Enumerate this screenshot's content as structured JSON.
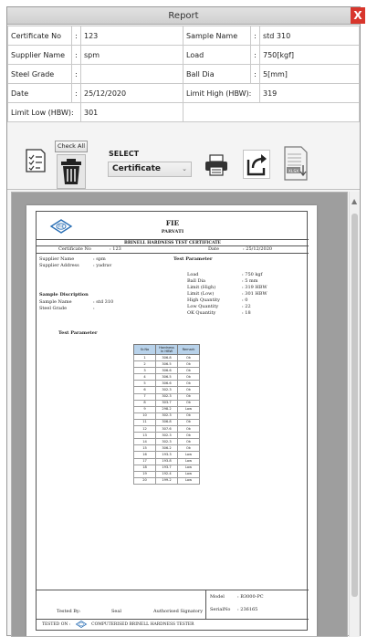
{
  "window": {
    "title": "Report",
    "close_label": "X"
  },
  "info": {
    "certificate_no": {
      "label": "Certificate No",
      "sep": ":",
      "value": "123"
    },
    "sample_name": {
      "label": "Sample Name",
      "sep": ":",
      "value": "std 310"
    },
    "supplier_name": {
      "label": "Supplier Name",
      "sep": ":",
      "value": "spm"
    },
    "load": {
      "label": "Load",
      "sep": ":",
      "value": "750[kgf]"
    },
    "steel_grade": {
      "label": "Steel Grade",
      "sep": ":",
      "value": ""
    },
    "ball_dia": {
      "label": "Ball Dia",
      "sep": ":",
      "value": "5[mm]"
    },
    "date": {
      "label": "Date",
      "sep": ":",
      "value": "25/12/2020"
    },
    "limit_high": {
      "label": "Limit High (HBW):",
      "value": "319"
    },
    "limit_low": {
      "label": "Limit Low (HBW):",
      "value": "301"
    }
  },
  "toolbar": {
    "check_all_label": "Check All",
    "select_label": "SELECT",
    "select_value": "Certificate",
    "icons": [
      "list-check-icon",
      "trash-icon",
      "printer-icon",
      "export-icon",
      "xlsx-download-icon"
    ]
  },
  "preview": {
    "company": "FIE",
    "company_sub": "PARVATI",
    "cert_title": "BRINELL HARDNESS TEST CERTIFICATE",
    "cert_no_label": "Certificate No",
    "cert_no": ": 123",
    "date_label": "Date",
    "date": ": 25/12/2020",
    "supplier_name_label": "Supplier Name",
    "supplier_name": ": spm",
    "supplier_address_label": "Supplier Address",
    "supplier_address": ": yadrav",
    "test_parameter_heading": "Test Parameter",
    "params": [
      {
        "label": "Load",
        "value": ": 750 kgf"
      },
      {
        "label": "Ball Dia",
        "value": ": 5 mm"
      },
      {
        "label": "Limit (High)",
        "value": ": 319 HBW"
      },
      {
        "label": "Limit (Low)",
        "value": ": 301 HBW"
      },
      {
        "label": "High Quantity",
        "value": ": 0"
      },
      {
        "label": "Low Quantity",
        "value": ": 22"
      },
      {
        "label": "OK Quantity",
        "value": ": 18"
      }
    ],
    "sample_description_heading": "Sample Discription",
    "sample_name_label": "Sample Name",
    "sample_name": ": std 310",
    "steel_grade_label": "Steel Grade",
    "steel_grade": ":",
    "test_parameter_label": "Test Parameter",
    "table_headers": [
      "Sr.No",
      "Hardness In HBW",
      "Remark"
    ],
    "table_rows": [
      [
        "1",
        "306.8",
        "Ok"
      ],
      [
        "2",
        "306.5",
        "Ok"
      ],
      [
        "3",
        "306.6",
        "Ok"
      ],
      [
        "4",
        "306.5",
        "Ok"
      ],
      [
        "5",
        "306.6",
        "Ok"
      ],
      [
        "6",
        "302.3",
        "Ok"
      ],
      [
        "7",
        "302.3",
        "Ok"
      ],
      [
        "8",
        "303.7",
        "Ok"
      ],
      [
        "9",
        "298.2",
        "Low"
      ],
      [
        "10",
        "302.3",
        "Ok"
      ],
      [
        "11",
        "306.8",
        "Ok"
      ],
      [
        "12",
        "307.6",
        "Ok"
      ],
      [
        "13",
        "302.3",
        "Ok"
      ],
      [
        "14",
        "302.3",
        "Ok"
      ],
      [
        "15",
        "306.2",
        "Ok"
      ],
      [
        "16",
        "193.3",
        "Low"
      ],
      [
        "17",
        "193.8",
        "Low"
      ],
      [
        "18",
        "193.7",
        "Low"
      ],
      [
        "19",
        "192.4",
        "Low"
      ],
      [
        "20",
        "199.2",
        "Low"
      ]
    ],
    "model_label": "Model",
    "model": ": B3000-PC",
    "serial_label": "SerialNo",
    "serial": ": 236165",
    "tested_by": "Tested By:",
    "seal": "Seal",
    "authorised": "Authorised Signatory",
    "footer_left": "TESTED ON :",
    "footer_right": "COMPUTERISED BRINELL HARDNESS TESTER"
  },
  "colors": {
    "table_header": "#b8d2ea",
    "close": "#d8362c",
    "logo": "#2a6fb5"
  }
}
